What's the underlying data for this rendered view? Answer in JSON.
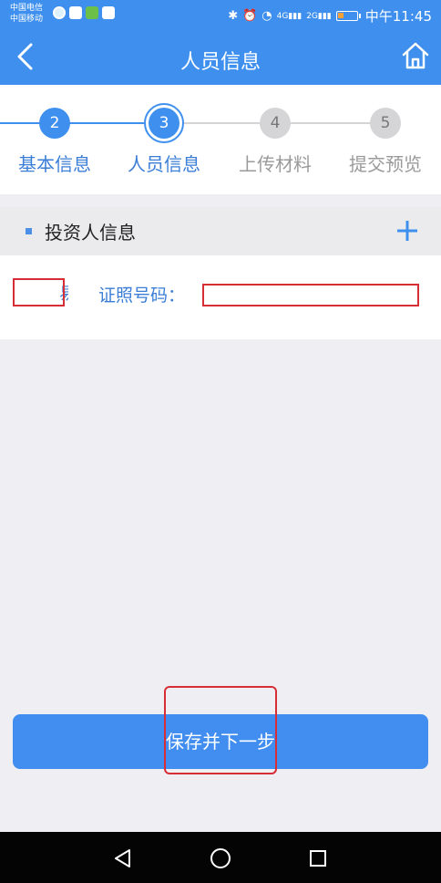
{
  "status_bar": {
    "carrier_1": "中国电信",
    "carrier_2": "中国移动",
    "signal_1": "4G",
    "signal_2": "2G",
    "time": "中午11:45"
  },
  "header": {
    "title": "人员信息"
  },
  "steps": [
    {
      "number": "2",
      "label": "基本信息",
      "state": "done"
    },
    {
      "number": "3",
      "label": "人员信息",
      "state": "active"
    },
    {
      "number": "4",
      "label": "上传材料",
      "state": "pending"
    },
    {
      "number": "5",
      "label": "提交预览",
      "state": "pending"
    }
  ],
  "section": {
    "title": "投资人信息"
  },
  "person_row": {
    "name_partial": "易",
    "cert_label": "证照号码："
  },
  "actions": {
    "save_next_label": "保存并下一步"
  },
  "colors": {
    "brand_blue": "#3f90ee",
    "accent_blue": "#3b7ed6",
    "step_pending": "#d5d5d7",
    "red_annotation": "#d72e36",
    "page_background": "#efeef3"
  }
}
